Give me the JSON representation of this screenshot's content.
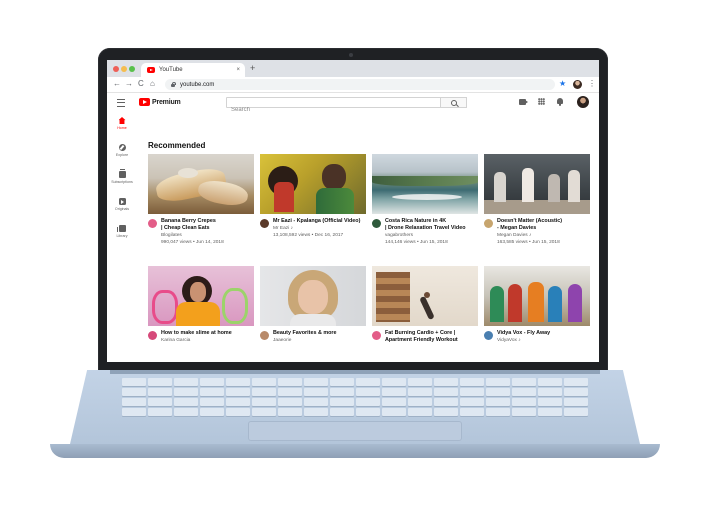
{
  "browser": {
    "tab_title": "YouTube",
    "tab_close": "×",
    "new_tab": "+",
    "url": "youtube.com",
    "nav": {
      "back": "←",
      "forward": "→",
      "reload": "C",
      "home": "⌂"
    },
    "star": "★",
    "menu": "⋮"
  },
  "header": {
    "brand": "Premium",
    "search_placeholder": "Search"
  },
  "sidebar": {
    "items": [
      {
        "label": "Home",
        "icon": "home-icon",
        "active": true
      },
      {
        "label": "Explore",
        "icon": "compass-icon"
      },
      {
        "label": "Subscriptions",
        "icon": "subscriptions-icon"
      },
      {
        "label": "Originals",
        "icon": "originals-icon"
      },
      {
        "label": "Library",
        "icon": "library-icon"
      }
    ]
  },
  "main": {
    "section_title": "Recommended",
    "videos": [
      {
        "title1": "Banana Berry Crepes",
        "title2": "| Cheap Clean Eats",
        "channel": "Blogilates",
        "meta": "990,047 views • Jun 14, 2018",
        "avatar_color": "#e35d88"
      },
      {
        "title1": "Mr Eazi - Kpalanga (Official Video)",
        "title2": "",
        "channel": "Mr Eazi ♪",
        "meta": "13,108,592 views • Dec 16, 2017",
        "avatar_color": "#5b3a2a"
      },
      {
        "title1": "Costa Rica Nature in 4K",
        "title2": "| Drone Relaxation Travel Video",
        "channel": "vagabrothers",
        "meta": "144,146 views • Jun 15, 2018",
        "avatar_color": "#2f5a3c"
      },
      {
        "title1": "Doesn't Matter (Acoustic)",
        "title2": "- Megan Davies",
        "channel": "Megan Davies ♪",
        "meta": "163,585 views • Jun 15, 2018",
        "avatar_color": "#c7a56e"
      },
      {
        "title1": "How to make slime at home",
        "title2": "",
        "channel": "Karina Garcia",
        "meta": "",
        "avatar_color": "#d64a7a"
      },
      {
        "title1": "Beauty Favorites & more",
        "title2": "",
        "channel": "Jaaeorie",
        "meta": "",
        "avatar_color": "#b88a6a"
      },
      {
        "title1": "Fat Burning Cardio + Core |",
        "title2": "Apartment Friendly Workout",
        "channel": "",
        "meta": "",
        "avatar_color": "#e35d88"
      },
      {
        "title1": "Vidya Vox - Fly Away",
        "title2": "",
        "channel": "VidyaVox ♪",
        "meta": "",
        "avatar_color": "#4a7fb0"
      }
    ]
  }
}
